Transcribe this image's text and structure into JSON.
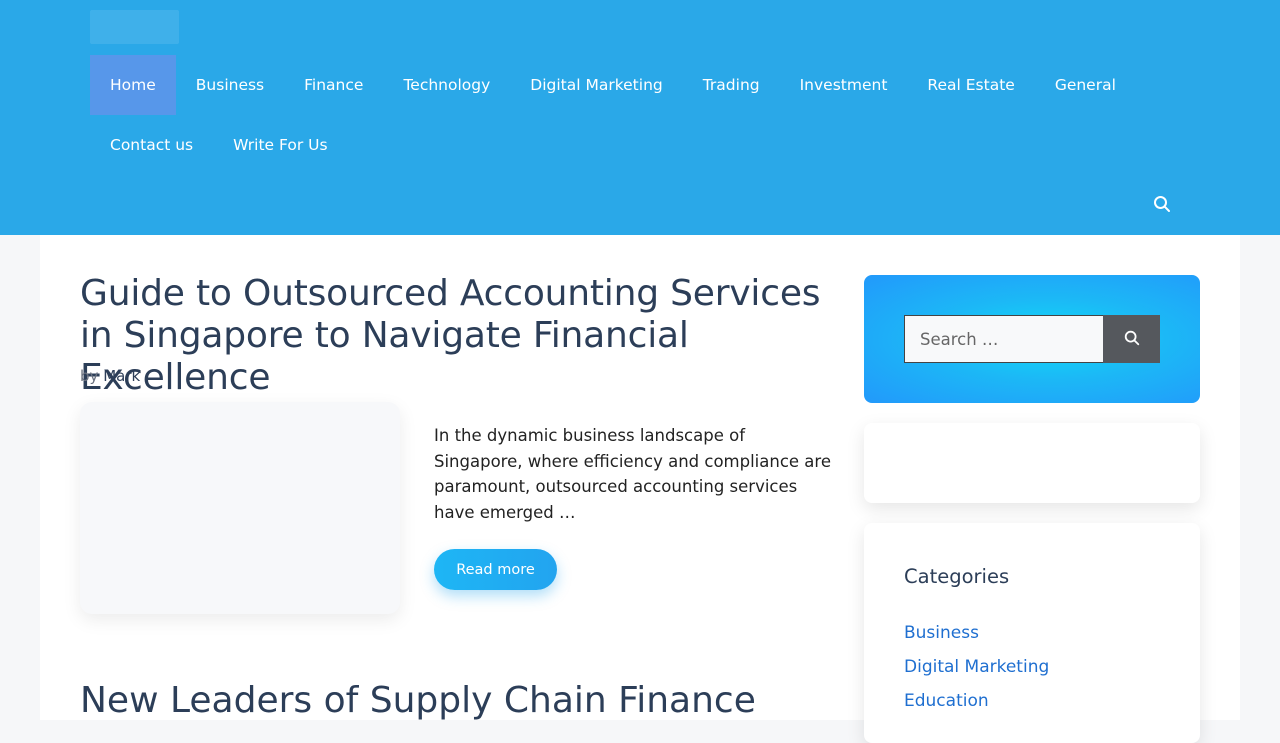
{
  "nav": {
    "items": [
      {
        "label": "Home",
        "active": true
      },
      {
        "label": "Business"
      },
      {
        "label": "Finance"
      },
      {
        "label": "Technology"
      },
      {
        "label": "Digital Marketing"
      },
      {
        "label": "Trading"
      },
      {
        "label": "Investment"
      },
      {
        "label": "Real Estate"
      },
      {
        "label": "General"
      },
      {
        "label": "Contact us"
      },
      {
        "label": "Write For Us"
      }
    ]
  },
  "post": {
    "title": "Guide to Outsourced Accounting Services in Singapore to Navigate Financial Excellence",
    "byline_prefix": "by",
    "author": "Mark",
    "excerpt": "In the dynamic business landscape of Singapore, where efficiency and compliance are paramount, outsourced accounting services have emerged …",
    "read_more": "Read more"
  },
  "post2": {
    "title": "New Leaders of Supply Chain Finance"
  },
  "sidebar": {
    "search_placeholder": "Search …",
    "categories_title": "Categories",
    "categories": [
      "Business",
      "Digital Marketing",
      "Education"
    ]
  },
  "colors": {
    "header": "#2aa8e8",
    "active_nav": "#5797ea",
    "title": "#2c3e58",
    "link": "#1f6fd0"
  },
  "icons": {
    "header_search": "search-icon",
    "search_submit": "search-icon"
  }
}
